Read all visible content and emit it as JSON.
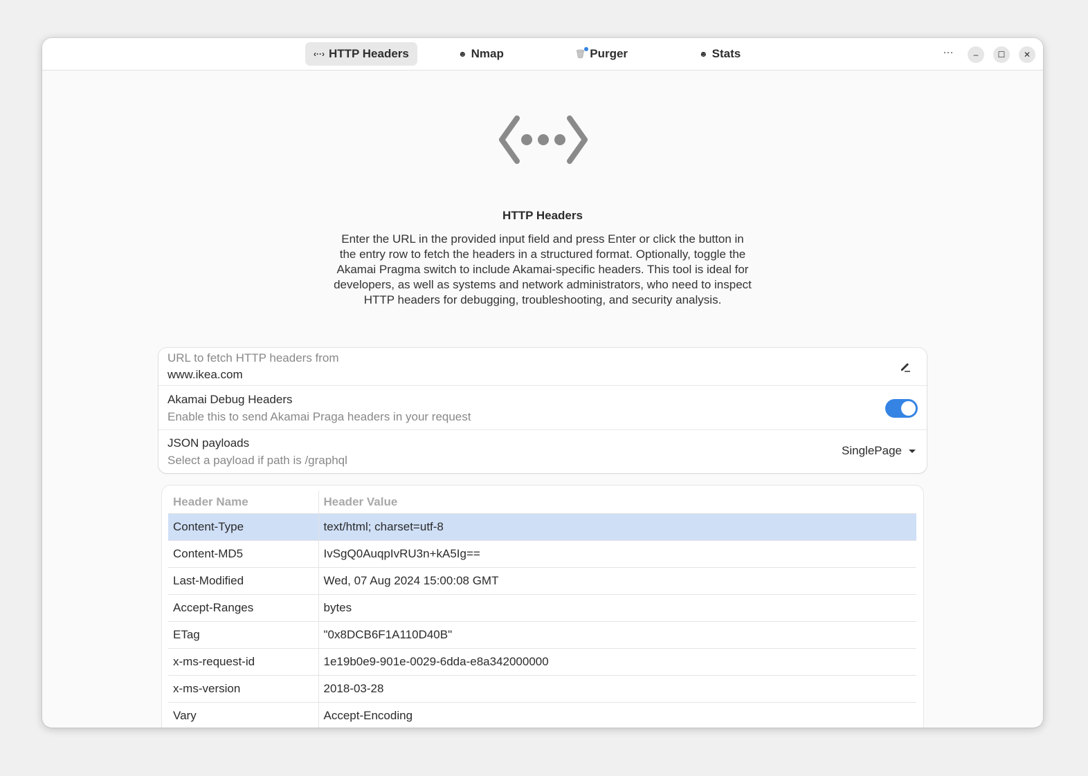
{
  "tabs": [
    {
      "label": "HTTP Headers",
      "icon": "‹··›",
      "icon_name": "code-icon",
      "active": true
    },
    {
      "label": "Nmap",
      "icon": "☻",
      "icon_name": "nmap-icon",
      "active": false
    },
    {
      "label": "Purger",
      "icon": "🗑",
      "icon_name": "trash-icon",
      "active": false,
      "badge": true
    },
    {
      "label": "Stats",
      "icon": "☻",
      "icon_name": "stats-icon",
      "active": false
    }
  ],
  "window_controls": {
    "menu": "···",
    "minimize": "–",
    "maximize": "☐",
    "close": "✕"
  },
  "page": {
    "title": "HTTP Headers",
    "description": "Enter the URL in the provided input field and press Enter or click the button in the entry row to fetch the headers in a structured format. Optionally, toggle the Akamai Pragma switch to include Akamai-specific headers. This tool is ideal for developers, as well as systems and network administrators, who need to inspect HTTP headers for debugging, troubleshooting, and security analysis."
  },
  "form": {
    "url_label": "URL to fetch HTTP headers from",
    "url_value": "www.ikea.com",
    "akamai_title": "Akamai Debug Headers",
    "akamai_subtitle": "Enable this to send Akamai Praga headers in your request",
    "akamai_enabled": true,
    "json_title": "JSON payloads",
    "json_subtitle": "Select a payload if path is /graphql",
    "json_selected": "SinglePage"
  },
  "table": {
    "columns": [
      "Header Name",
      "Header Value"
    ],
    "rows": [
      [
        "Content-Type",
        "text/html; charset=utf-8"
      ],
      [
        "Content-MD5",
        "IvSgQ0AuqpIvRU3n+kA5Ig=="
      ],
      [
        "Last-Modified",
        "Wed, 07 Aug 2024 15:00:08 GMT"
      ],
      [
        "Accept-Ranges",
        "bytes"
      ],
      [
        "ETag",
        "\"0x8DCB6F1A110D40B\""
      ],
      [
        "x-ms-request-id",
        "1e19b0e9-901e-0029-6dda-e8a342000000"
      ],
      [
        "x-ms-version",
        "2018-03-28"
      ],
      [
        "Vary",
        "Accept-Encoding"
      ]
    ],
    "selected_row": 0
  },
  "colors": {
    "accent": "#3584e4",
    "selection": "#cfdff6"
  }
}
